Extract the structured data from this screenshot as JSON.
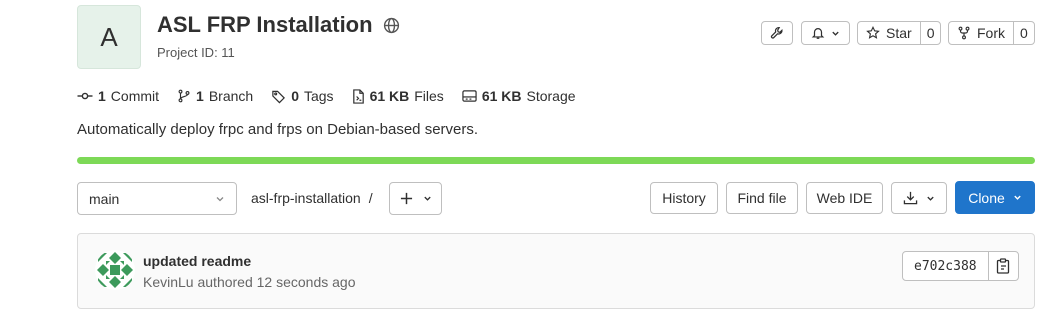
{
  "project": {
    "avatar_letter": "A",
    "title": "ASL FRP Installation",
    "project_id": "Project ID: 11",
    "description": "Automatically deploy frpc and frps on Debian-based servers."
  },
  "actions": {
    "star_label": "Star",
    "star_count": "0",
    "fork_label": "Fork",
    "fork_count": "0"
  },
  "stats": [
    {
      "icon": "commit-icon",
      "count": "1",
      "label": "Commit"
    },
    {
      "icon": "branch-icon",
      "count": "1",
      "label": "Branch"
    },
    {
      "icon": "tag-icon",
      "count": "0",
      "label": "Tags"
    },
    {
      "icon": "file-icon",
      "count": "61 KB",
      "label": "Files"
    },
    {
      "icon": "storage-icon",
      "count": "61 KB",
      "label": "Storage"
    }
  ],
  "language_bar": {
    "color": "#7dd957",
    "fraction": 1.0
  },
  "repo_nav": {
    "branch": "main",
    "path": "asl-frp-installation",
    "separator": "/",
    "history": "History",
    "find_file": "Find file",
    "web_ide": "Web IDE",
    "clone": "Clone"
  },
  "last_commit": {
    "title": "updated readme",
    "meta": "KevinLu authored 12 seconds ago",
    "sha": "e702c388"
  },
  "colors": {
    "accent": "#1f75cb",
    "identicon": "#3d9a5c"
  }
}
